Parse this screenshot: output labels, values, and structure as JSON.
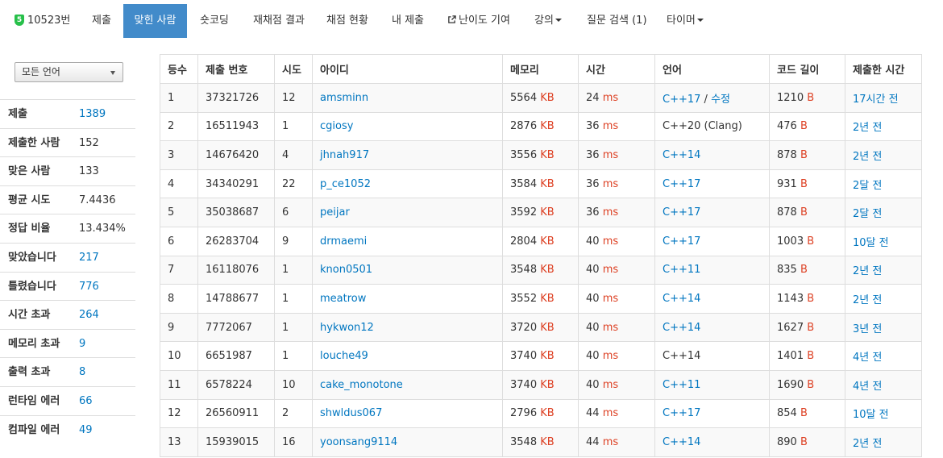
{
  "nav": {
    "problem": {
      "badge": "5",
      "label": "10523번"
    },
    "items": [
      {
        "label": "제출"
      },
      {
        "label": "맞힌 사람",
        "active": true
      },
      {
        "label": "숏코딩"
      },
      {
        "label": "재채점 결과"
      },
      {
        "label": "채점 현황"
      },
      {
        "label": "내 제출"
      },
      {
        "label": "난이도 기여"
      },
      {
        "label": "강의"
      },
      {
        "label": "질문 검색 (1)"
      },
      {
        "label": "타이머"
      }
    ]
  },
  "filter": {
    "language_selected": "모든 언어"
  },
  "stats": [
    {
      "label": "제출",
      "value": "1389",
      "link": true
    },
    {
      "label": "제출한 사람",
      "value": "152",
      "link": false
    },
    {
      "label": "맞은 사람",
      "value": "133",
      "link": false
    },
    {
      "label": "평균 시도",
      "value": "7.4436",
      "link": false
    },
    {
      "label": "정답 비율",
      "value": "13.434%",
      "link": false
    },
    {
      "label": "맞았습니다",
      "value": "217",
      "link": true
    },
    {
      "label": "틀렸습니다",
      "value": "776",
      "link": true
    },
    {
      "label": "시간 초과",
      "value": "264",
      "link": true
    },
    {
      "label": "메모리 초과",
      "value": "9",
      "link": true
    },
    {
      "label": "출력 초과",
      "value": "8",
      "link": true
    },
    {
      "label": "런타임 에러",
      "value": "66",
      "link": true
    },
    {
      "label": "컴파일 에러",
      "value": "49",
      "link": true
    }
  ],
  "table": {
    "columns": [
      "등수",
      "제출 번호",
      "시도",
      "아이디",
      "메모리",
      "시간",
      "언어",
      "코드 길이",
      "제출한 시간"
    ],
    "units": {
      "memory": "KB",
      "time": "ms",
      "length": "B"
    },
    "edit_label": "수정",
    "rows": [
      {
        "rank": "1",
        "submission": "37321726",
        "tries": "12",
        "user": "amsminn",
        "memory": "5564",
        "time": "24",
        "lang": "C++17",
        "lang_link": true,
        "edit": true,
        "length": "1210",
        "submitted": "17시간 전"
      },
      {
        "rank": "2",
        "submission": "16511943",
        "tries": "1",
        "user": "cgiosy",
        "memory": "2876",
        "time": "36",
        "lang": "C++20 (Clang)",
        "lang_link": false,
        "edit": false,
        "length": "476",
        "submitted": "2년 전"
      },
      {
        "rank": "3",
        "submission": "14676420",
        "tries": "4",
        "user": "jhnah917",
        "memory": "3556",
        "time": "36",
        "lang": "C++14",
        "lang_link": true,
        "edit": false,
        "length": "878",
        "submitted": "2년 전"
      },
      {
        "rank": "4",
        "submission": "34340291",
        "tries": "22",
        "user": "p_ce1052",
        "memory": "3584",
        "time": "36",
        "lang": "C++17",
        "lang_link": true,
        "edit": false,
        "length": "931",
        "submitted": "2달 전"
      },
      {
        "rank": "5",
        "submission": "35038687",
        "tries": "6",
        "user": "peijar",
        "memory": "3592",
        "time": "36",
        "lang": "C++17",
        "lang_link": true,
        "edit": false,
        "length": "878",
        "submitted": "2달 전"
      },
      {
        "rank": "6",
        "submission": "26283704",
        "tries": "9",
        "user": "drmaemi",
        "memory": "2804",
        "time": "40",
        "lang": "C++17",
        "lang_link": true,
        "edit": false,
        "length": "1003",
        "submitted": "10달 전"
      },
      {
        "rank": "7",
        "submission": "16118076",
        "tries": "1",
        "user": "knon0501",
        "memory": "3548",
        "time": "40",
        "lang": "C++11",
        "lang_link": true,
        "edit": false,
        "length": "835",
        "submitted": "2년 전"
      },
      {
        "rank": "8",
        "submission": "14788677",
        "tries": "1",
        "user": "meatrow",
        "memory": "3552",
        "time": "40",
        "lang": "C++14",
        "lang_link": true,
        "edit": false,
        "length": "1143",
        "submitted": "2년 전"
      },
      {
        "rank": "9",
        "submission": "7772067",
        "tries": "1",
        "user": "hykwon12",
        "memory": "3720",
        "time": "40",
        "lang": "C++14",
        "lang_link": true,
        "edit": false,
        "length": "1627",
        "submitted": "3년 전"
      },
      {
        "rank": "10",
        "submission": "6651987",
        "tries": "1",
        "user": "louche49",
        "memory": "3740",
        "time": "40",
        "lang": "C++14",
        "lang_link": false,
        "edit": false,
        "length": "1401",
        "submitted": "4년 전"
      },
      {
        "rank": "11",
        "submission": "6578224",
        "tries": "10",
        "user": "cake_monotone",
        "memory": "3740",
        "time": "40",
        "lang": "C++11",
        "lang_link": true,
        "edit": false,
        "length": "1690",
        "submitted": "4년 전"
      },
      {
        "rank": "12",
        "submission": "26560911",
        "tries": "2",
        "user": "shwldus067",
        "memory": "2796",
        "time": "44",
        "lang": "C++17",
        "lang_link": true,
        "edit": false,
        "length": "854",
        "submitted": "10달 전"
      },
      {
        "rank": "13",
        "submission": "15939015",
        "tries": "16",
        "user": "yoonsang9114",
        "memory": "3548",
        "time": "44",
        "lang": "C++14",
        "lang_link": true,
        "edit": false,
        "length": "890",
        "submitted": "2년 전"
      }
    ]
  },
  "colors": {
    "accent": "#428bca",
    "link": "#0076c0",
    "unit": "#dd4124",
    "badge": "#27c04a"
  }
}
